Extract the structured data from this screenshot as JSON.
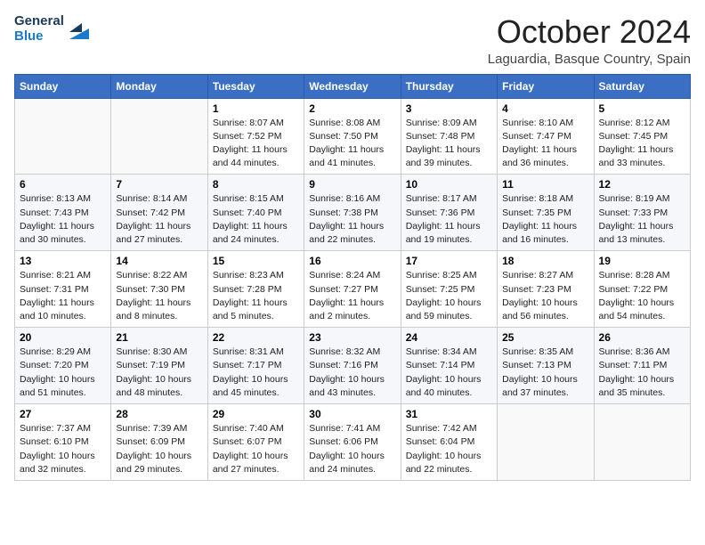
{
  "logo": {
    "line1": "General",
    "line2": "Blue"
  },
  "title": "October 2024",
  "subtitle": "Laguardia, Basque Country, Spain",
  "weekdays": [
    "Sunday",
    "Monday",
    "Tuesday",
    "Wednesday",
    "Thursday",
    "Friday",
    "Saturday"
  ],
  "weeks": [
    [
      {
        "day": "",
        "text": ""
      },
      {
        "day": "",
        "text": ""
      },
      {
        "day": "1",
        "text": "Sunrise: 8:07 AM\nSunset: 7:52 PM\nDaylight: 11 hours and 44 minutes."
      },
      {
        "day": "2",
        "text": "Sunrise: 8:08 AM\nSunset: 7:50 PM\nDaylight: 11 hours and 41 minutes."
      },
      {
        "day": "3",
        "text": "Sunrise: 8:09 AM\nSunset: 7:48 PM\nDaylight: 11 hours and 39 minutes."
      },
      {
        "day": "4",
        "text": "Sunrise: 8:10 AM\nSunset: 7:47 PM\nDaylight: 11 hours and 36 minutes."
      },
      {
        "day": "5",
        "text": "Sunrise: 8:12 AM\nSunset: 7:45 PM\nDaylight: 11 hours and 33 minutes."
      }
    ],
    [
      {
        "day": "6",
        "text": "Sunrise: 8:13 AM\nSunset: 7:43 PM\nDaylight: 11 hours and 30 minutes."
      },
      {
        "day": "7",
        "text": "Sunrise: 8:14 AM\nSunset: 7:42 PM\nDaylight: 11 hours and 27 minutes."
      },
      {
        "day": "8",
        "text": "Sunrise: 8:15 AM\nSunset: 7:40 PM\nDaylight: 11 hours and 24 minutes."
      },
      {
        "day": "9",
        "text": "Sunrise: 8:16 AM\nSunset: 7:38 PM\nDaylight: 11 hours and 22 minutes."
      },
      {
        "day": "10",
        "text": "Sunrise: 8:17 AM\nSunset: 7:36 PM\nDaylight: 11 hours and 19 minutes."
      },
      {
        "day": "11",
        "text": "Sunrise: 8:18 AM\nSunset: 7:35 PM\nDaylight: 11 hours and 16 minutes."
      },
      {
        "day": "12",
        "text": "Sunrise: 8:19 AM\nSunset: 7:33 PM\nDaylight: 11 hours and 13 minutes."
      }
    ],
    [
      {
        "day": "13",
        "text": "Sunrise: 8:21 AM\nSunset: 7:31 PM\nDaylight: 11 hours and 10 minutes."
      },
      {
        "day": "14",
        "text": "Sunrise: 8:22 AM\nSunset: 7:30 PM\nDaylight: 11 hours and 8 minutes."
      },
      {
        "day": "15",
        "text": "Sunrise: 8:23 AM\nSunset: 7:28 PM\nDaylight: 11 hours and 5 minutes."
      },
      {
        "day": "16",
        "text": "Sunrise: 8:24 AM\nSunset: 7:27 PM\nDaylight: 11 hours and 2 minutes."
      },
      {
        "day": "17",
        "text": "Sunrise: 8:25 AM\nSunset: 7:25 PM\nDaylight: 10 hours and 59 minutes."
      },
      {
        "day": "18",
        "text": "Sunrise: 8:27 AM\nSunset: 7:23 PM\nDaylight: 10 hours and 56 minutes."
      },
      {
        "day": "19",
        "text": "Sunrise: 8:28 AM\nSunset: 7:22 PM\nDaylight: 10 hours and 54 minutes."
      }
    ],
    [
      {
        "day": "20",
        "text": "Sunrise: 8:29 AM\nSunset: 7:20 PM\nDaylight: 10 hours and 51 minutes."
      },
      {
        "day": "21",
        "text": "Sunrise: 8:30 AM\nSunset: 7:19 PM\nDaylight: 10 hours and 48 minutes."
      },
      {
        "day": "22",
        "text": "Sunrise: 8:31 AM\nSunset: 7:17 PM\nDaylight: 10 hours and 45 minutes."
      },
      {
        "day": "23",
        "text": "Sunrise: 8:32 AM\nSunset: 7:16 PM\nDaylight: 10 hours and 43 minutes."
      },
      {
        "day": "24",
        "text": "Sunrise: 8:34 AM\nSunset: 7:14 PM\nDaylight: 10 hours and 40 minutes."
      },
      {
        "day": "25",
        "text": "Sunrise: 8:35 AM\nSunset: 7:13 PM\nDaylight: 10 hours and 37 minutes."
      },
      {
        "day": "26",
        "text": "Sunrise: 8:36 AM\nSunset: 7:11 PM\nDaylight: 10 hours and 35 minutes."
      }
    ],
    [
      {
        "day": "27",
        "text": "Sunrise: 7:37 AM\nSunset: 6:10 PM\nDaylight: 10 hours and 32 minutes."
      },
      {
        "day": "28",
        "text": "Sunrise: 7:39 AM\nSunset: 6:09 PM\nDaylight: 10 hours and 29 minutes."
      },
      {
        "day": "29",
        "text": "Sunrise: 7:40 AM\nSunset: 6:07 PM\nDaylight: 10 hours and 27 minutes."
      },
      {
        "day": "30",
        "text": "Sunrise: 7:41 AM\nSunset: 6:06 PM\nDaylight: 10 hours and 24 minutes."
      },
      {
        "day": "31",
        "text": "Sunrise: 7:42 AM\nSunset: 6:04 PM\nDaylight: 10 hours and 22 minutes."
      },
      {
        "day": "",
        "text": ""
      },
      {
        "day": "",
        "text": ""
      }
    ]
  ]
}
